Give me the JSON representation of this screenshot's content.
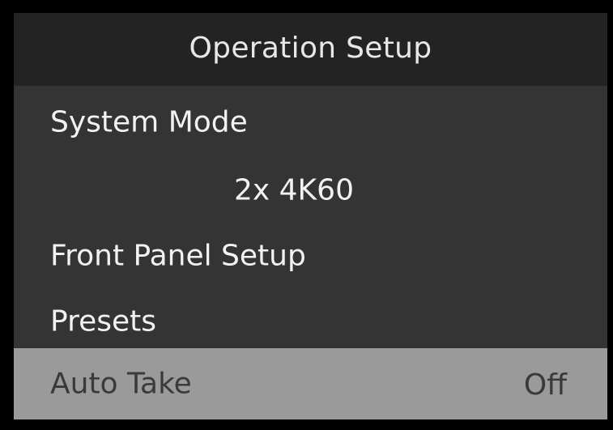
{
  "title": "Operation Setup",
  "menu": {
    "system_mode": {
      "label": "System Mode",
      "value": "2x 4K60"
    },
    "front_panel_setup": {
      "label": "Front Panel Setup"
    },
    "presets": {
      "label": "Presets"
    },
    "auto_take": {
      "label": "Auto Take",
      "value": "Off"
    }
  },
  "colors": {
    "bezel": "#000000",
    "title_bar": "#232323",
    "menu_background": "#343434",
    "selected_row": "#9a9a9a",
    "text": "#f2f2f2",
    "selected_text": "#3a3a3a"
  }
}
